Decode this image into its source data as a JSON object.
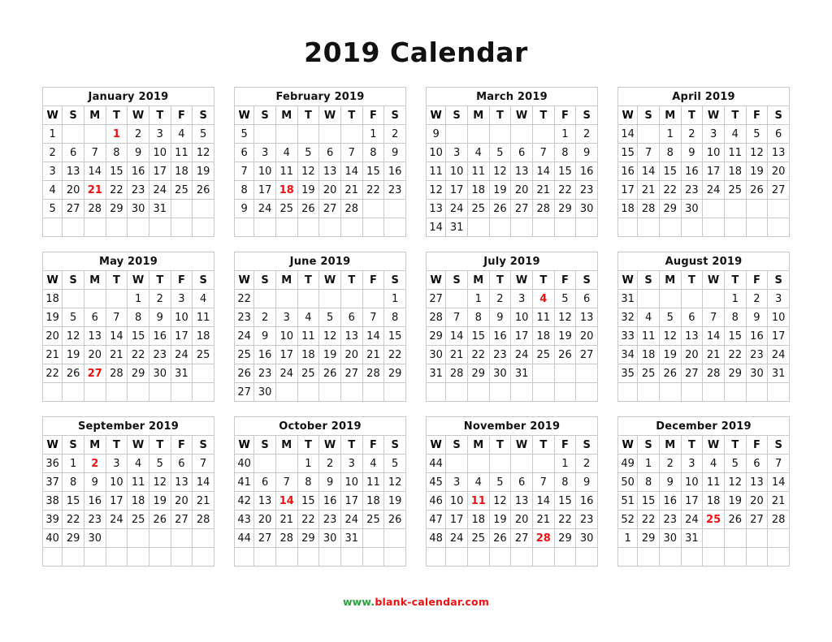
{
  "title": "2019 Calendar",
  "footer": {
    "prefix": "www.",
    "rest": "blank-calendar.com"
  },
  "colors": {
    "holiday": "#ee1111",
    "weeknumber": "#2f9e41",
    "text": "#111111",
    "border": "#c8c8c8"
  },
  "weekday_headers": [
    "W",
    "S",
    "M",
    "T",
    "W",
    "T",
    "F",
    "S"
  ],
  "months": [
    {
      "name": "January 2019",
      "weeks": [
        {
          "w": "1",
          "days": [
            "",
            "",
            "1",
            "2",
            "3",
            "4",
            "5"
          ],
          "holidays": [
            "1"
          ]
        },
        {
          "w": "2",
          "days": [
            "6",
            "7",
            "8",
            "9",
            "10",
            "11",
            "12"
          ],
          "holidays": []
        },
        {
          "w": "3",
          "days": [
            "13",
            "14",
            "15",
            "16",
            "17",
            "18",
            "19"
          ],
          "holidays": []
        },
        {
          "w": "4",
          "days": [
            "20",
            "21",
            "22",
            "23",
            "24",
            "25",
            "26"
          ],
          "holidays": [
            "21"
          ]
        },
        {
          "w": "5",
          "days": [
            "27",
            "28",
            "29",
            "30",
            "31",
            "",
            ""
          ],
          "holidays": []
        },
        {
          "w": "",
          "days": [
            "",
            "",
            "",
            "",
            "",
            "",
            ""
          ],
          "holidays": []
        }
      ]
    },
    {
      "name": "February 2019",
      "weeks": [
        {
          "w": "5",
          "days": [
            "",
            "",
            "",
            "",
            "",
            "1",
            "2"
          ],
          "holidays": []
        },
        {
          "w": "6",
          "days": [
            "3",
            "4",
            "5",
            "6",
            "7",
            "8",
            "9"
          ],
          "holidays": []
        },
        {
          "w": "7",
          "days": [
            "10",
            "11",
            "12",
            "13",
            "14",
            "15",
            "16"
          ],
          "holidays": []
        },
        {
          "w": "8",
          "days": [
            "17",
            "18",
            "19",
            "20",
            "21",
            "22",
            "23"
          ],
          "holidays": [
            "18"
          ]
        },
        {
          "w": "9",
          "days": [
            "24",
            "25",
            "26",
            "27",
            "28",
            "",
            ""
          ],
          "holidays": []
        },
        {
          "w": "",
          "days": [
            "",
            "",
            "",
            "",
            "",
            "",
            ""
          ],
          "holidays": []
        }
      ]
    },
    {
      "name": "March 2019",
      "weeks": [
        {
          "w": "9",
          "days": [
            "",
            "",
            "",
            "",
            "",
            "1",
            "2"
          ],
          "holidays": []
        },
        {
          "w": "10",
          "days": [
            "3",
            "4",
            "5",
            "6",
            "7",
            "8",
            "9"
          ],
          "holidays": []
        },
        {
          "w": "11",
          "days": [
            "10",
            "11",
            "12",
            "13",
            "14",
            "15",
            "16"
          ],
          "holidays": []
        },
        {
          "w": "12",
          "days": [
            "17",
            "18",
            "19",
            "20",
            "21",
            "22",
            "23"
          ],
          "holidays": []
        },
        {
          "w": "13",
          "days": [
            "24",
            "25",
            "26",
            "27",
            "28",
            "29",
            "30"
          ],
          "holidays": []
        },
        {
          "w": "14",
          "days": [
            "31",
            "",
            "",
            "",
            "",
            "",
            ""
          ],
          "holidays": []
        }
      ]
    },
    {
      "name": "April 2019",
      "weeks": [
        {
          "w": "14",
          "days": [
            "",
            "1",
            "2",
            "3",
            "4",
            "5",
            "6"
          ],
          "holidays": []
        },
        {
          "w": "15",
          "days": [
            "7",
            "8",
            "9",
            "10",
            "11",
            "12",
            "13"
          ],
          "holidays": []
        },
        {
          "w": "16",
          "days": [
            "14",
            "15",
            "16",
            "17",
            "18",
            "19",
            "20"
          ],
          "holidays": []
        },
        {
          "w": "17",
          "days": [
            "21",
            "22",
            "23",
            "24",
            "25",
            "26",
            "27"
          ],
          "holidays": []
        },
        {
          "w": "18",
          "days": [
            "28",
            "29",
            "30",
            "",
            "",
            "",
            ""
          ],
          "holidays": []
        },
        {
          "w": "",
          "days": [
            "",
            "",
            "",
            "",
            "",
            "",
            ""
          ],
          "holidays": []
        }
      ]
    },
    {
      "name": "May 2019",
      "weeks": [
        {
          "w": "18",
          "days": [
            "",
            "",
            "",
            "1",
            "2",
            "3",
            "4"
          ],
          "holidays": []
        },
        {
          "w": "19",
          "days": [
            "5",
            "6",
            "7",
            "8",
            "9",
            "10",
            "11"
          ],
          "holidays": []
        },
        {
          "w": "20",
          "days": [
            "12",
            "13",
            "14",
            "15",
            "16",
            "17",
            "18"
          ],
          "holidays": []
        },
        {
          "w": "21",
          "days": [
            "19",
            "20",
            "21",
            "22",
            "23",
            "24",
            "25"
          ],
          "holidays": []
        },
        {
          "w": "22",
          "days": [
            "26",
            "27",
            "28",
            "29",
            "30",
            "31",
            ""
          ],
          "holidays": [
            "27"
          ]
        },
        {
          "w": "",
          "days": [
            "",
            "",
            "",
            "",
            "",
            "",
            ""
          ],
          "holidays": []
        }
      ]
    },
    {
      "name": "June 2019",
      "weeks": [
        {
          "w": "22",
          "days": [
            "",
            "",
            "",
            "",
            "",
            "",
            "1"
          ],
          "holidays": []
        },
        {
          "w": "23",
          "days": [
            "2",
            "3",
            "4",
            "5",
            "6",
            "7",
            "8"
          ],
          "holidays": []
        },
        {
          "w": "24",
          "days": [
            "9",
            "10",
            "11",
            "12",
            "13",
            "14",
            "15"
          ],
          "holidays": []
        },
        {
          "w": "25",
          "days": [
            "16",
            "17",
            "18",
            "19",
            "20",
            "21",
            "22"
          ],
          "holidays": []
        },
        {
          "w": "26",
          "days": [
            "23",
            "24",
            "25",
            "26",
            "27",
            "28",
            "29"
          ],
          "holidays": []
        },
        {
          "w": "27",
          "days": [
            "30",
            "",
            "",
            "",
            "",
            "",
            ""
          ],
          "holidays": []
        }
      ]
    },
    {
      "name": "July 2019",
      "weeks": [
        {
          "w": "27",
          "days": [
            "",
            "1",
            "2",
            "3",
            "4",
            "5",
            "6"
          ],
          "holidays": [
            "4"
          ]
        },
        {
          "w": "28",
          "days": [
            "7",
            "8",
            "9",
            "10",
            "11",
            "12",
            "13"
          ],
          "holidays": []
        },
        {
          "w": "29",
          "days": [
            "14",
            "15",
            "16",
            "17",
            "18",
            "19",
            "20"
          ],
          "holidays": []
        },
        {
          "w": "30",
          "days": [
            "21",
            "22",
            "23",
            "24",
            "25",
            "26",
            "27"
          ],
          "holidays": []
        },
        {
          "w": "31",
          "days": [
            "28",
            "29",
            "30",
            "31",
            "",
            "",
            ""
          ],
          "holidays": []
        },
        {
          "w": "",
          "days": [
            "",
            "",
            "",
            "",
            "",
            "",
            ""
          ],
          "holidays": []
        }
      ]
    },
    {
      "name": "August 2019",
      "weeks": [
        {
          "w": "31",
          "days": [
            "",
            "",
            "",
            "",
            "1",
            "2",
            "3"
          ],
          "holidays": []
        },
        {
          "w": "32",
          "days": [
            "4",
            "5",
            "6",
            "7",
            "8",
            "9",
            "10"
          ],
          "holidays": []
        },
        {
          "w": "33",
          "days": [
            "11",
            "12",
            "13",
            "14",
            "15",
            "16",
            "17"
          ],
          "holidays": []
        },
        {
          "w": "34",
          "days": [
            "18",
            "19",
            "20",
            "21",
            "22",
            "23",
            "24"
          ],
          "holidays": []
        },
        {
          "w": "35",
          "days": [
            "25",
            "26",
            "27",
            "28",
            "29",
            "30",
            "31"
          ],
          "holidays": []
        },
        {
          "w": "",
          "days": [
            "",
            "",
            "",
            "",
            "",
            "",
            ""
          ],
          "holidays": []
        }
      ]
    },
    {
      "name": "September 2019",
      "weeks": [
        {
          "w": "36",
          "days": [
            "1",
            "2",
            "3",
            "4",
            "5",
            "6",
            "7"
          ],
          "holidays": [
            "2"
          ]
        },
        {
          "w": "37",
          "days": [
            "8",
            "9",
            "10",
            "11",
            "12",
            "13",
            "14"
          ],
          "holidays": []
        },
        {
          "w": "38",
          "days": [
            "15",
            "16",
            "17",
            "18",
            "19",
            "20",
            "21"
          ],
          "holidays": []
        },
        {
          "w": "39",
          "days": [
            "22",
            "23",
            "24",
            "25",
            "26",
            "27",
            "28"
          ],
          "holidays": []
        },
        {
          "w": "40",
          "days": [
            "29",
            "30",
            "",
            "",
            "",
            "",
            ""
          ],
          "holidays": []
        },
        {
          "w": "",
          "days": [
            "",
            "",
            "",
            "",
            "",
            "",
            ""
          ],
          "holidays": []
        }
      ]
    },
    {
      "name": "October 2019",
      "weeks": [
        {
          "w": "40",
          "days": [
            "",
            "",
            "1",
            "2",
            "3",
            "4",
            "5"
          ],
          "holidays": []
        },
        {
          "w": "41",
          "days": [
            "6",
            "7",
            "8",
            "9",
            "10",
            "11",
            "12"
          ],
          "holidays": []
        },
        {
          "w": "42",
          "days": [
            "13",
            "14",
            "15",
            "16",
            "17",
            "18",
            "19"
          ],
          "holidays": [
            "14"
          ]
        },
        {
          "w": "43",
          "days": [
            "20",
            "21",
            "22",
            "23",
            "24",
            "25",
            "26"
          ],
          "holidays": []
        },
        {
          "w": "44",
          "days": [
            "27",
            "28",
            "29",
            "30",
            "31",
            "",
            ""
          ],
          "holidays": []
        },
        {
          "w": "",
          "days": [
            "",
            "",
            "",
            "",
            "",
            "",
            ""
          ],
          "holidays": []
        }
      ]
    },
    {
      "name": "November 2019",
      "weeks": [
        {
          "w": "44",
          "days": [
            "",
            "",
            "",
            "",
            "",
            "1",
            "2"
          ],
          "holidays": []
        },
        {
          "w": "45",
          "days": [
            "3",
            "4",
            "5",
            "6",
            "7",
            "8",
            "9"
          ],
          "holidays": []
        },
        {
          "w": "46",
          "days": [
            "10",
            "11",
            "12",
            "13",
            "14",
            "15",
            "16"
          ],
          "holidays": [
            "11"
          ]
        },
        {
          "w": "47",
          "days": [
            "17",
            "18",
            "19",
            "20",
            "21",
            "22",
            "23"
          ],
          "holidays": []
        },
        {
          "w": "48",
          "days": [
            "24",
            "25",
            "26",
            "27",
            "28",
            "29",
            "30"
          ],
          "holidays": [
            "28"
          ]
        },
        {
          "w": "",
          "days": [
            "",
            "",
            "",
            "",
            "",
            "",
            ""
          ],
          "holidays": []
        }
      ]
    },
    {
      "name": "December 2019",
      "weeks": [
        {
          "w": "49",
          "days": [
            "1",
            "2",
            "3",
            "4",
            "5",
            "6",
            "7"
          ],
          "holidays": []
        },
        {
          "w": "50",
          "days": [
            "8",
            "9",
            "10",
            "11",
            "12",
            "13",
            "14"
          ],
          "holidays": []
        },
        {
          "w": "51",
          "days": [
            "15",
            "16",
            "17",
            "18",
            "19",
            "20",
            "21"
          ],
          "holidays": []
        },
        {
          "w": "52",
          "days": [
            "22",
            "23",
            "24",
            "25",
            "26",
            "27",
            "28"
          ],
          "holidays": [
            "25"
          ]
        },
        {
          "w": "1",
          "days": [
            "29",
            "30",
            "31",
            "",
            "",
            "",
            ""
          ],
          "holidays": []
        },
        {
          "w": "",
          "days": [
            "",
            "",
            "",
            "",
            "",
            "",
            ""
          ],
          "holidays": []
        }
      ]
    }
  ]
}
